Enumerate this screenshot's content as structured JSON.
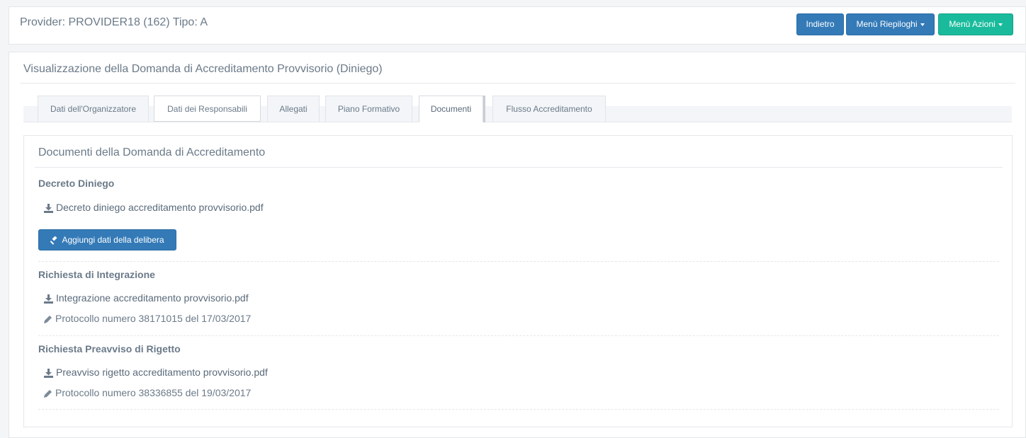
{
  "header": {
    "provider_title": "Provider: PROVIDER18 (162) Tipo: A",
    "buttons": {
      "back": "Indietro",
      "summary_menu": "Menù Riepiloghi",
      "actions_menu": "Menù Azioni"
    }
  },
  "panel": {
    "title": "Visualizzazione della Domanda di Accreditamento Provvisorio (Diniego)",
    "tabs": [
      {
        "label": "Dati dell'Organizzatore"
      },
      {
        "label": "Dati dei Responsabili"
      },
      {
        "label": "Allegati"
      },
      {
        "label": "Piano Formativo"
      },
      {
        "label": "Documenti"
      },
      {
        "label": "Flusso Accreditamento"
      }
    ],
    "active_tab": "Documenti"
  },
  "documents": {
    "title": "Documenti della Domanda di Accreditamento",
    "sections": [
      {
        "heading": "Decreto Diniego",
        "file": "Decreto diniego accreditamento provvisorio.pdf",
        "button": "Aggiungi dati della delibera"
      },
      {
        "heading": "Richiesta di Integrazione",
        "file": "Integrazione accreditamento provvisorio.pdf",
        "protocol": "Protocollo numero 38171015 del 17/03/2017"
      },
      {
        "heading": "Richiesta Preavviso di Rigetto",
        "file": "Preavviso rigetto accreditamento provvisorio.pdf",
        "protocol": "Protocollo numero 38336855 del 19/03/2017"
      }
    ]
  },
  "icons": {
    "download": "download-icon",
    "pencil": "pencil-icon",
    "gavel": "gavel-icon"
  },
  "colors": {
    "primary": "#337ab7",
    "success": "#1abb9c",
    "text": "#5a6a7a"
  }
}
